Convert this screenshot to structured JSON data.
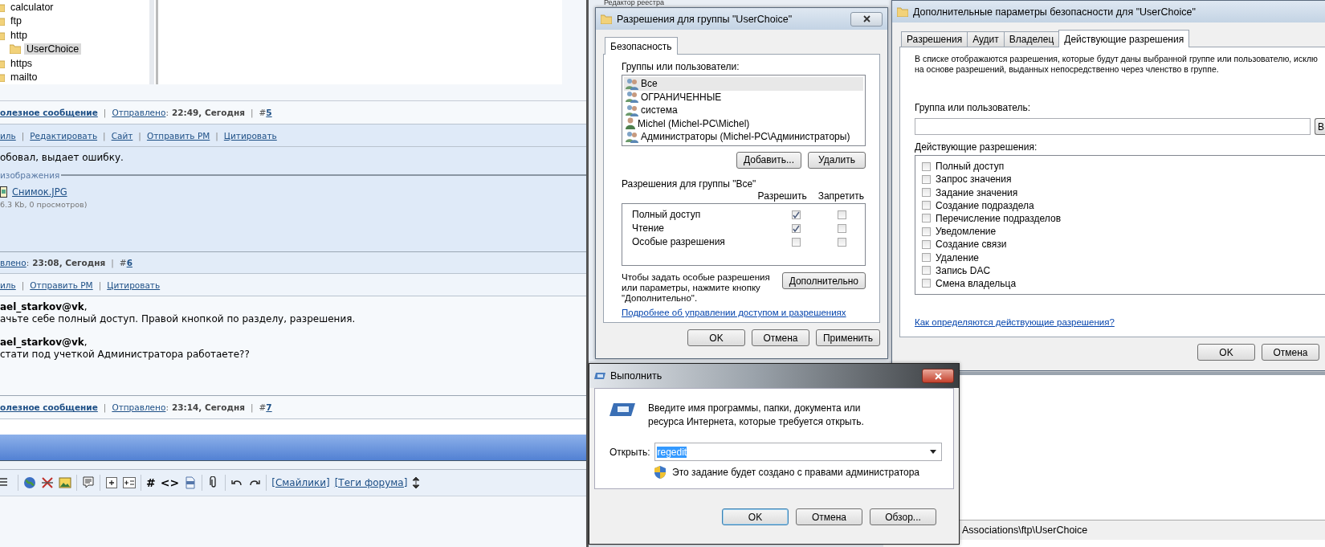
{
  "background_window": {
    "title": "Редактор реестра"
  },
  "forum": {
    "registry_tree": [
      {
        "label": "calculator",
        "selected": false
      },
      {
        "label": "ftp",
        "selected": false
      },
      {
        "label": "http",
        "selected": false
      },
      {
        "label": "UserChoice",
        "selected": true
      },
      {
        "label": "https",
        "selected": false
      },
      {
        "label": "mailto",
        "selected": false
      }
    ],
    "rows": [
      {
        "kind": "footer",
        "parts": [
          {
            "kind": "link_bold",
            "text": "олезное сообщение"
          },
          {
            "kind": "sep",
            "text": "|"
          },
          {
            "kind": "link",
            "text": "Отправлено"
          },
          {
            "kind": "text",
            "text": ":"
          },
          {
            "kind": "bold",
            "text": "22:49, Сегодня"
          },
          {
            "kind": "sep",
            "text": "|"
          },
          {
            "kind": "text",
            "text": "#"
          },
          {
            "kind": "link_bold",
            "text": "5"
          }
        ]
      },
      {
        "kind": "actions",
        "parts": [
          {
            "kind": "link",
            "text": "иль"
          },
          {
            "kind": "sep",
            "text": "|"
          },
          {
            "kind": "link",
            "text": "Редактировать"
          },
          {
            "kind": "sep",
            "text": "|"
          },
          {
            "kind": "link",
            "text": "Сайт"
          },
          {
            "kind": "sep",
            "text": "|"
          },
          {
            "kind": "link",
            "text": "Отправить PM"
          },
          {
            "kind": "sep",
            "text": "|"
          },
          {
            "kind": "link",
            "text": "Цитировать"
          }
        ]
      },
      {
        "kind": "message",
        "text": "обовал, выдает ошибку.",
        "legend": "изображения",
        "attachment": "Снимок.JPG",
        "attachment_info": "6.3 Kb, 0 просмотров)"
      },
      {
        "kind": "header",
        "parts": [
          {
            "kind": "link",
            "text": "влено"
          },
          {
            "kind": "text",
            "text": ":"
          },
          {
            "kind": "bold",
            "text": "23:08, Сегодня"
          },
          {
            "kind": "sep",
            "text": "|"
          },
          {
            "kind": "text",
            "text": "#"
          },
          {
            "kind": "link_bold",
            "text": "6"
          }
        ]
      },
      {
        "kind": "actions",
        "parts": [
          {
            "kind": "link",
            "text": "иль"
          },
          {
            "kind": "sep",
            "text": "|"
          },
          {
            "kind": "link",
            "text": "Отправить PM"
          },
          {
            "kind": "sep",
            "text": "|"
          },
          {
            "kind": "link",
            "text": "Цитировать"
          }
        ]
      },
      {
        "kind": "quotes",
        "lines": [
          "**ael_starkov@vk**,",
          "ачьте себе полный доступ. Правой кнопкой по разделу, разрешения.",
          "**ael_starkov@vk**,",
          "стати под учеткой Администратора работаете??"
        ]
      },
      {
        "kind": "footer",
        "parts": [
          {
            "kind": "link_bold",
            "text": "олезное сообщение"
          },
          {
            "kind": "sep",
            "text": "|"
          },
          {
            "kind": "link",
            "text": "Отправлено"
          },
          {
            "kind": "text",
            "text": ":"
          },
          {
            "kind": "bold",
            "text": "23:14, Сегодня"
          },
          {
            "kind": "sep",
            "text": "|"
          },
          {
            "kind": "text",
            "text": "#"
          },
          {
            "kind": "link_bold",
            "text": "7"
          }
        ]
      }
    ],
    "editor_toolbar": {
      "glyphs": [
        "#",
        "<>"
      ],
      "links": [
        "[Смайлики]",
        "[Теги форума]"
      ]
    }
  },
  "permissions_dialog": {
    "title": "Разрешения для группы \"UserChoice\"",
    "tabs": [
      {
        "label": "Безопасность",
        "selected": true
      }
    ],
    "groups_label": "Группы или пользователи:",
    "groups": [
      {
        "name": "Все",
        "kind": "group",
        "selected": true
      },
      {
        "name": "ОГРАНИЧЕННЫЕ",
        "kind": "group",
        "selected": false
      },
      {
        "name": "система",
        "kind": "group",
        "selected": false
      },
      {
        "name": "Michel (Michel-PC\\Michel)",
        "kind": "user",
        "selected": false
      },
      {
        "name": "Администраторы (Michel-PC\\Администраторы)",
        "kind": "group",
        "selected": false
      }
    ],
    "group_buttons": [
      "Добавить...",
      "Удалить"
    ],
    "permissions_label": "Разрешения для группы \"Все\"",
    "columns": [
      "Разрешить",
      "Запретить"
    ],
    "permissions": [
      {
        "name": "Полный доступ",
        "allow_checked": true,
        "deny_checked": false
      },
      {
        "name": "Чтение",
        "allow_checked": true,
        "deny_checked": false
      },
      {
        "name": "Особые разрешения",
        "allow_checked": false,
        "deny_checked": false
      }
    ],
    "hint": "Чтобы задать особые разрешения или параметры, нажмите кнопку \"Дополнительно\".",
    "advanced_button": "Дополнительно",
    "help_link": "Подробнее об управлении доступом и разрешениях",
    "buttons": [
      "OK",
      "Отмена",
      "Применить"
    ]
  },
  "advanced_dialog": {
    "title": "Дополнительные параметры безопасности  для \"UserChoice\"",
    "tabs": [
      {
        "label": "Разрешения",
        "selected": false
      },
      {
        "label": "Аудит",
        "selected": false
      },
      {
        "label": "Владелец",
        "selected": false
      },
      {
        "label": "Действующие разрешения",
        "selected": true
      }
    ],
    "description_lines": [
      "В списке отображаются разрешения, которые будут даны выбранной группе или пользователю, исклю",
      "на основе разрешений, выданных непосредственно через членство в группе."
    ],
    "group_label": "Группа или пользователь:",
    "select_button": "В",
    "effective_label": "Действующие разрешения:",
    "permissions": [
      {
        "name": "Полный доступ",
        "checked": false
      },
      {
        "name": "Запрос значения",
        "checked": false
      },
      {
        "name": "Задание значения",
        "checked": false
      },
      {
        "name": "Создание подраздела",
        "checked": false
      },
      {
        "name": "Перечисление подразделов",
        "checked": false
      },
      {
        "name": "Уведомление",
        "checked": false
      },
      {
        "name": "Создание связи",
        "checked": false
      },
      {
        "name": "Удаление",
        "checked": false
      },
      {
        "name": "Запись DAC",
        "checked": false
      },
      {
        "name": "Смена владельца",
        "checked": false
      }
    ],
    "help_link": "Как определяются действующие разрешения?",
    "buttons": [
      "OK",
      "Отмена"
    ]
  },
  "registry_status": "Associations\\ftp\\UserChoice",
  "run_dialog": {
    "title": "Выполнить",
    "prompt": "Введите имя программы, папки, документа или ресурса Интернета, которые требуется открыть.",
    "open_label": "Открыть:",
    "open_value": "regedit",
    "admin_note": "Это задание будет создано с правами администратора",
    "buttons": [
      "OK",
      "Отмена",
      "Обзор..."
    ]
  }
}
